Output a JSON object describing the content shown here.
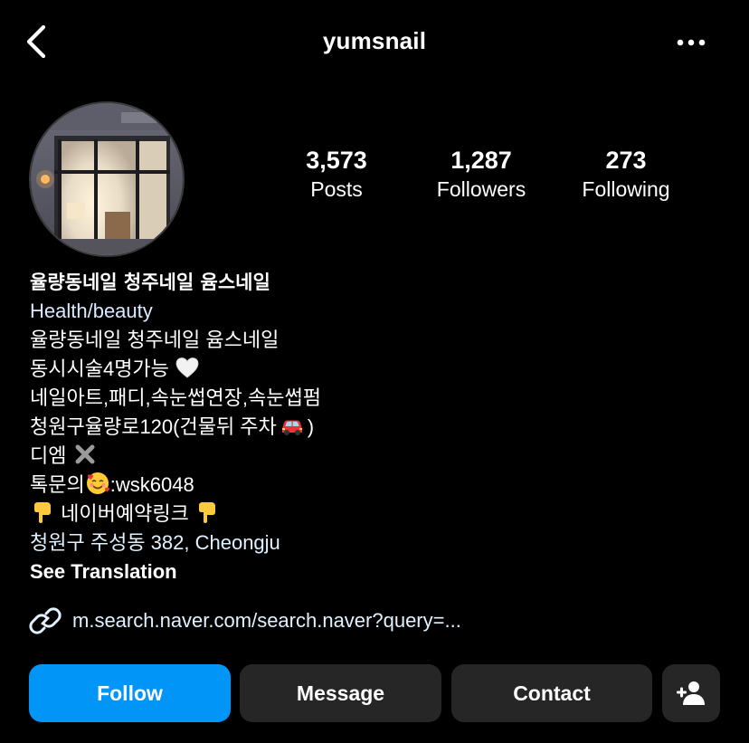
{
  "header": {
    "username": "yumsnail"
  },
  "stats": [
    {
      "value": "3,573",
      "label": "Posts"
    },
    {
      "value": "1,287",
      "label": "Followers"
    },
    {
      "value": "273",
      "label": "Following"
    }
  ],
  "bio": {
    "name": "율량동네일 청주네일 윰스네일",
    "category": "Health/beauty",
    "lines": [
      "율량동네일 청주네일 윰스네일",
      "동시시술4명가능",
      "네일아트,패디,속눈썹연장,속눈썹펌",
      "청원구율량로120(건물뒤 주차",
      ")",
      "디엠",
      "톡문의",
      ":wsk6048",
      "네이버예약링크"
    ],
    "location": "청원구 주성동 382, Cheongju",
    "see_translation": "See Translation"
  },
  "link": {
    "text": "m.search.naver.com/search.naver?query=..."
  },
  "buttons": {
    "follow": "Follow",
    "message": "Message",
    "contact": "Contact"
  },
  "icons": {
    "back": "chevron-left-icon",
    "more": "more-horizontal-icon",
    "link": "link-icon",
    "add_person": "add-person-icon",
    "heart": "white-heart-emoji",
    "car": "red-car-emoji",
    "cross": "cross-mark-emoji",
    "smile": "smiling-face-with-hearts-emoji",
    "point_down": "pointing-down-emoji"
  },
  "colors": {
    "background": "#000000",
    "follow_button": "#0095f6",
    "secondary_button": "#262626",
    "link_text": "#e0f1ff"
  }
}
